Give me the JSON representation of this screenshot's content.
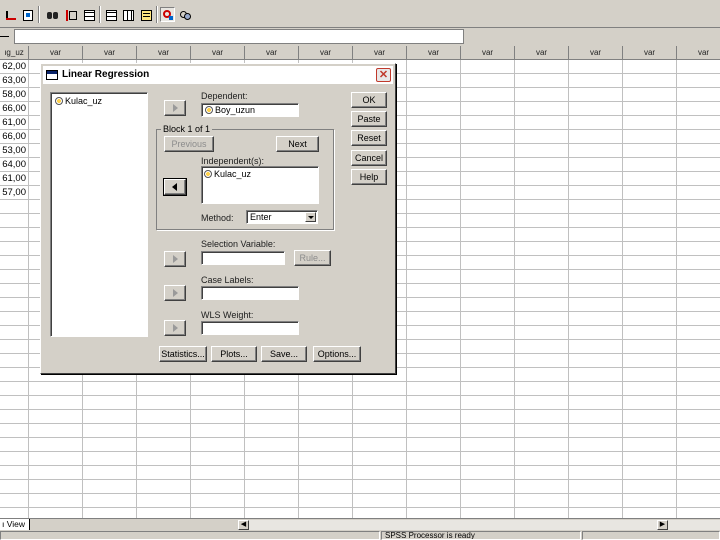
{
  "toolbar": {
    "icons": [
      "goto-case-icon",
      "variables-icon",
      "find-icon",
      "insert-case-icon",
      "insert-variable-icon",
      "split-file-icon",
      "weight-cases-icon",
      "select-cases-icon",
      "value-labels-icon",
      "use-sets-icon"
    ]
  },
  "grid": {
    "first_header": "ıg_uz",
    "column_headers": [
      "var",
      "var",
      "var",
      "var",
      "var",
      "var",
      "var",
      "var",
      "var",
      "var",
      "var",
      "var",
      "var"
    ],
    "first_column_values": [
      "62,00",
      "63,00",
      "58,00",
      "66,00",
      "61,00",
      "66,00",
      "53,00",
      "64,00",
      "61,00",
      "57,00"
    ]
  },
  "bottom": {
    "tab_label": "ı View",
    "status_text": "SPSS Processor  is ready"
  },
  "dialog": {
    "title": "Linear Regression",
    "close_glyph": "✕",
    "source_variables": [
      "Kulac_uz"
    ],
    "dependent_label": "Dependent:",
    "dependent_value": "Boy_uzun",
    "block_label": "Block 1 of 1",
    "previous_button": "Previous",
    "next_button": "Next",
    "independents_label": "Independent(s):",
    "independents": [
      "Kulac_uz"
    ],
    "method_label": "Method:",
    "method_value": "Enter",
    "selection_label": "Selection Variable:",
    "rule_button": "Rule...",
    "case_labels_label": "Case Labels:",
    "wls_label": "WLS Weight:",
    "buttons": {
      "ok": "OK",
      "paste": "Paste",
      "reset": "Reset",
      "cancel": "Cancel",
      "help": "Help",
      "statistics": "Statistics...",
      "plots": "Plots...",
      "save": "Save...",
      "options": "Options..."
    }
  }
}
